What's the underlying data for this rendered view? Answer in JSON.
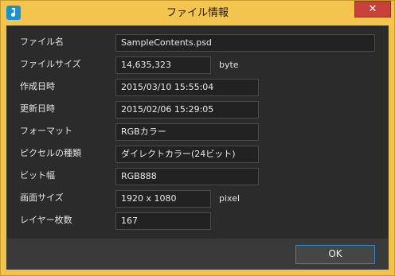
{
  "window": {
    "title": "ファイル情報",
    "close_glyph": "✕",
    "app_icon_glyph": "♪"
  },
  "rows": [
    {
      "label": "ファイル名",
      "value": "SampleContents.psd",
      "unit": ""
    },
    {
      "label": "ファイルサイズ",
      "value": "14,635,323",
      "unit": "byte"
    },
    {
      "label": "作成日時",
      "value": "2015/03/10 15:55:04",
      "unit": ""
    },
    {
      "label": "更新日時",
      "value": "2015/02/06 15:29:05",
      "unit": ""
    },
    {
      "label": "フォーマット",
      "value": "RGBカラー",
      "unit": ""
    },
    {
      "label": "ピクセルの種類",
      "value": "ダイレクトカラー(24ビット)",
      "unit": ""
    },
    {
      "label": "ビット幅",
      "value": "RGB888",
      "unit": ""
    },
    {
      "label": "画面サイズ",
      "value": "1920 x 1080",
      "unit": "pixel"
    },
    {
      "label": "レイヤー枚数",
      "value": "167",
      "unit": ""
    }
  ],
  "footer": {
    "ok_label": "OK"
  },
  "colors": {
    "title_bar": "#f4c54e",
    "close_button": "#c7413a",
    "dialog_background": "#2b2b2b",
    "field_background": "#222222",
    "accent_border": "#2e87c7"
  }
}
